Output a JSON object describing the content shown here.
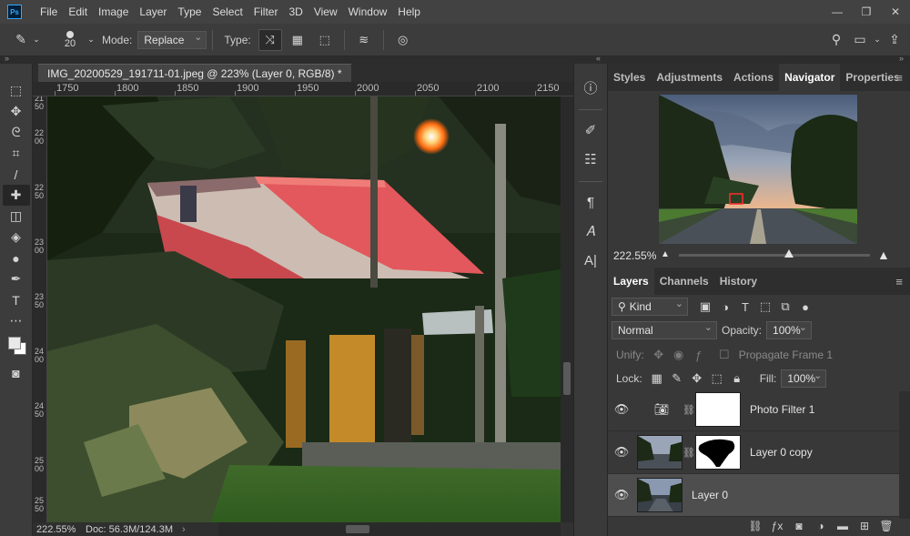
{
  "menubar": {
    "logo": "Ps",
    "items": [
      "File",
      "Edit",
      "Image",
      "Layer",
      "Type",
      "Select",
      "Filter",
      "3D",
      "View",
      "Window",
      "Help"
    ]
  },
  "options": {
    "brush_size": "20",
    "mode_label": "Mode:",
    "mode_value": "Replace",
    "type_label": "Type:"
  },
  "document": {
    "tab_title": "IMG_20200529_191711-01.jpeg @ 223% (Layer 0, RGB/8) *",
    "ruler_h": [
      "1750",
      "1800",
      "1850",
      "1900",
      "1950",
      "2000",
      "2050",
      "2100",
      "2150"
    ],
    "ruler_v": [
      "2150",
      "2200",
      "2250",
      "2300",
      "2350",
      "2400",
      "2450",
      "2500",
      "2550"
    ],
    "status_zoom": "222.55%",
    "status_doc": "Doc: 56.3M/124.3M"
  },
  "navigator_group": {
    "tabs": [
      "Styles",
      "Adjustments",
      "Actions",
      "Navigator",
      "Properties"
    ],
    "active_tab": "Navigator",
    "zoom": "222.55%"
  },
  "layers_group": {
    "tabs": [
      "Layers",
      "Channels",
      "History"
    ],
    "active_tab": "Layers",
    "filter_kind": "Kind",
    "blend_mode": "Normal",
    "opacity_label": "Opacity:",
    "opacity_value": "100%",
    "unify_label": "Unify:",
    "propagate_label": "Propagate Frame 1",
    "lock_label": "Lock:",
    "fill_label": "Fill:",
    "fill_value": "100%",
    "layers": [
      {
        "name": "Photo Filter 1"
      },
      {
        "name": "Layer 0 copy"
      },
      {
        "name": "Layer 0"
      }
    ]
  },
  "colors": {
    "accent": "#31a8ff",
    "roof": "#e2585c",
    "panel": "#383838"
  }
}
